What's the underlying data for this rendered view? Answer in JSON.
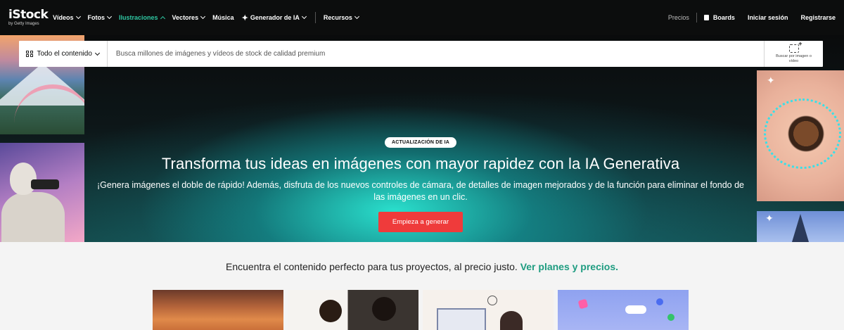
{
  "brand": {
    "name": "iStock",
    "tagline": "by Getty Images"
  },
  "nav": {
    "items": [
      {
        "label": "Vídeos",
        "chevron": true,
        "active": false
      },
      {
        "label": "Fotos",
        "chevron": true,
        "active": false
      },
      {
        "label": "Ilustraciones",
        "chevron": true,
        "active": true
      },
      {
        "label": "Vectores",
        "chevron": true,
        "active": false
      },
      {
        "label": "Música",
        "chevron": false,
        "active": false
      },
      {
        "label": "Generador de IA",
        "chevron": true,
        "active": false
      },
      {
        "label": "Recursos",
        "chevron": true,
        "active": false
      }
    ],
    "right": {
      "pricing": "Precios",
      "boards": "Boards",
      "login": "Iniciar sesión",
      "register": "Registrarse"
    }
  },
  "search": {
    "filter_label": "Todo el contenido",
    "placeholder": "Busca millones de imágenes y vídeos de stock de calidad premium",
    "visual_search_label": "Buscar por imagen o vídeo"
  },
  "hero": {
    "badge": "ACTUALIZACIÓN DE IA",
    "title": "Transforma tus ideas en imágenes con mayor rapidez con la IA Generativa",
    "subtitle": "¡Genera imágenes el doble de rápido! Además, disfruta de los nuevos controles de cámara, de detalles de imagen mejorados y de la función para eliminar el fondo de las imágenes en un clic.",
    "cta": "Empieza a generar"
  },
  "promo": {
    "text": "Encuentra el contenido perfecto para tus proyectos, al precio justo.",
    "link": "Ver planes y precios."
  },
  "colors": {
    "accent": "#2fc8a3",
    "cta": "#ef3b3b",
    "nav_bg": "#0c0d0d",
    "link": "#1e9c80"
  }
}
